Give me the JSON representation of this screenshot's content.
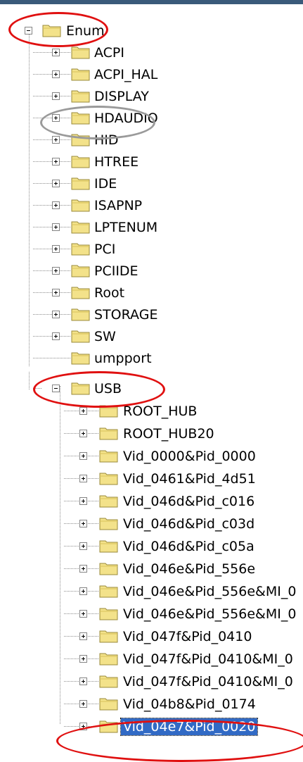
{
  "tree": {
    "root": {
      "label": "Enum",
      "expanded": true
    },
    "children": [
      {
        "label": "ACPI",
        "expanded": false
      },
      {
        "label": "ACPI_HAL",
        "expanded": false
      },
      {
        "label": "DISPLAY",
        "expanded": false
      },
      {
        "label": "HDAUDIO",
        "expanded": false
      },
      {
        "label": "HID",
        "expanded": false
      },
      {
        "label": "HTREE",
        "expanded": false
      },
      {
        "label": "IDE",
        "expanded": false
      },
      {
        "label": "ISAPNP",
        "expanded": false
      },
      {
        "label": "LPTENUM",
        "expanded": false
      },
      {
        "label": "PCI",
        "expanded": false
      },
      {
        "label": "PCIIDE",
        "expanded": false
      },
      {
        "label": "Root",
        "expanded": false
      },
      {
        "label": "STORAGE",
        "expanded": false
      },
      {
        "label": "SW",
        "expanded": false
      },
      {
        "label": "umpport",
        "expanded": null
      }
    ],
    "usb": {
      "label": "USB",
      "expanded": true
    },
    "usb_children": [
      {
        "label": "ROOT_HUB",
        "selected": false
      },
      {
        "label": "ROOT_HUB20",
        "selected": false
      },
      {
        "label": "Vid_0000&Pid_0000",
        "selected": false
      },
      {
        "label": "Vid_0461&Pid_4d51",
        "selected": false
      },
      {
        "label": "Vid_046d&Pid_c016",
        "selected": false
      },
      {
        "label": "Vid_046d&Pid_c03d",
        "selected": false
      },
      {
        "label": "Vid_046d&Pid_c05a",
        "selected": false
      },
      {
        "label": "Vid_046e&Pid_556e",
        "selected": false
      },
      {
        "label": "Vid_046e&Pid_556e&MI_0",
        "selected": false
      },
      {
        "label": "Vid_046e&Pid_556e&MI_0",
        "selected": false
      },
      {
        "label": "Vid_047f&Pid_0410",
        "selected": false
      },
      {
        "label": "Vid_047f&Pid_0410&MI_0",
        "selected": false
      },
      {
        "label": "Vid_047f&Pid_0410&MI_0",
        "selected": false
      },
      {
        "label": "Vid_04b8&Pid_0174",
        "selected": false
      },
      {
        "label": "Vid_04e7&Pid_0020",
        "selected": true
      }
    ]
  },
  "colors": {
    "highlight_red": "#e01010",
    "highlight_gray": "#9a9a9a",
    "selection": "#316ac5",
    "folder_fill": "#f3e28a"
  },
  "icons": {
    "folder": "folder-icon",
    "expand": "plus-box-icon",
    "collapse": "minus-box-icon"
  }
}
